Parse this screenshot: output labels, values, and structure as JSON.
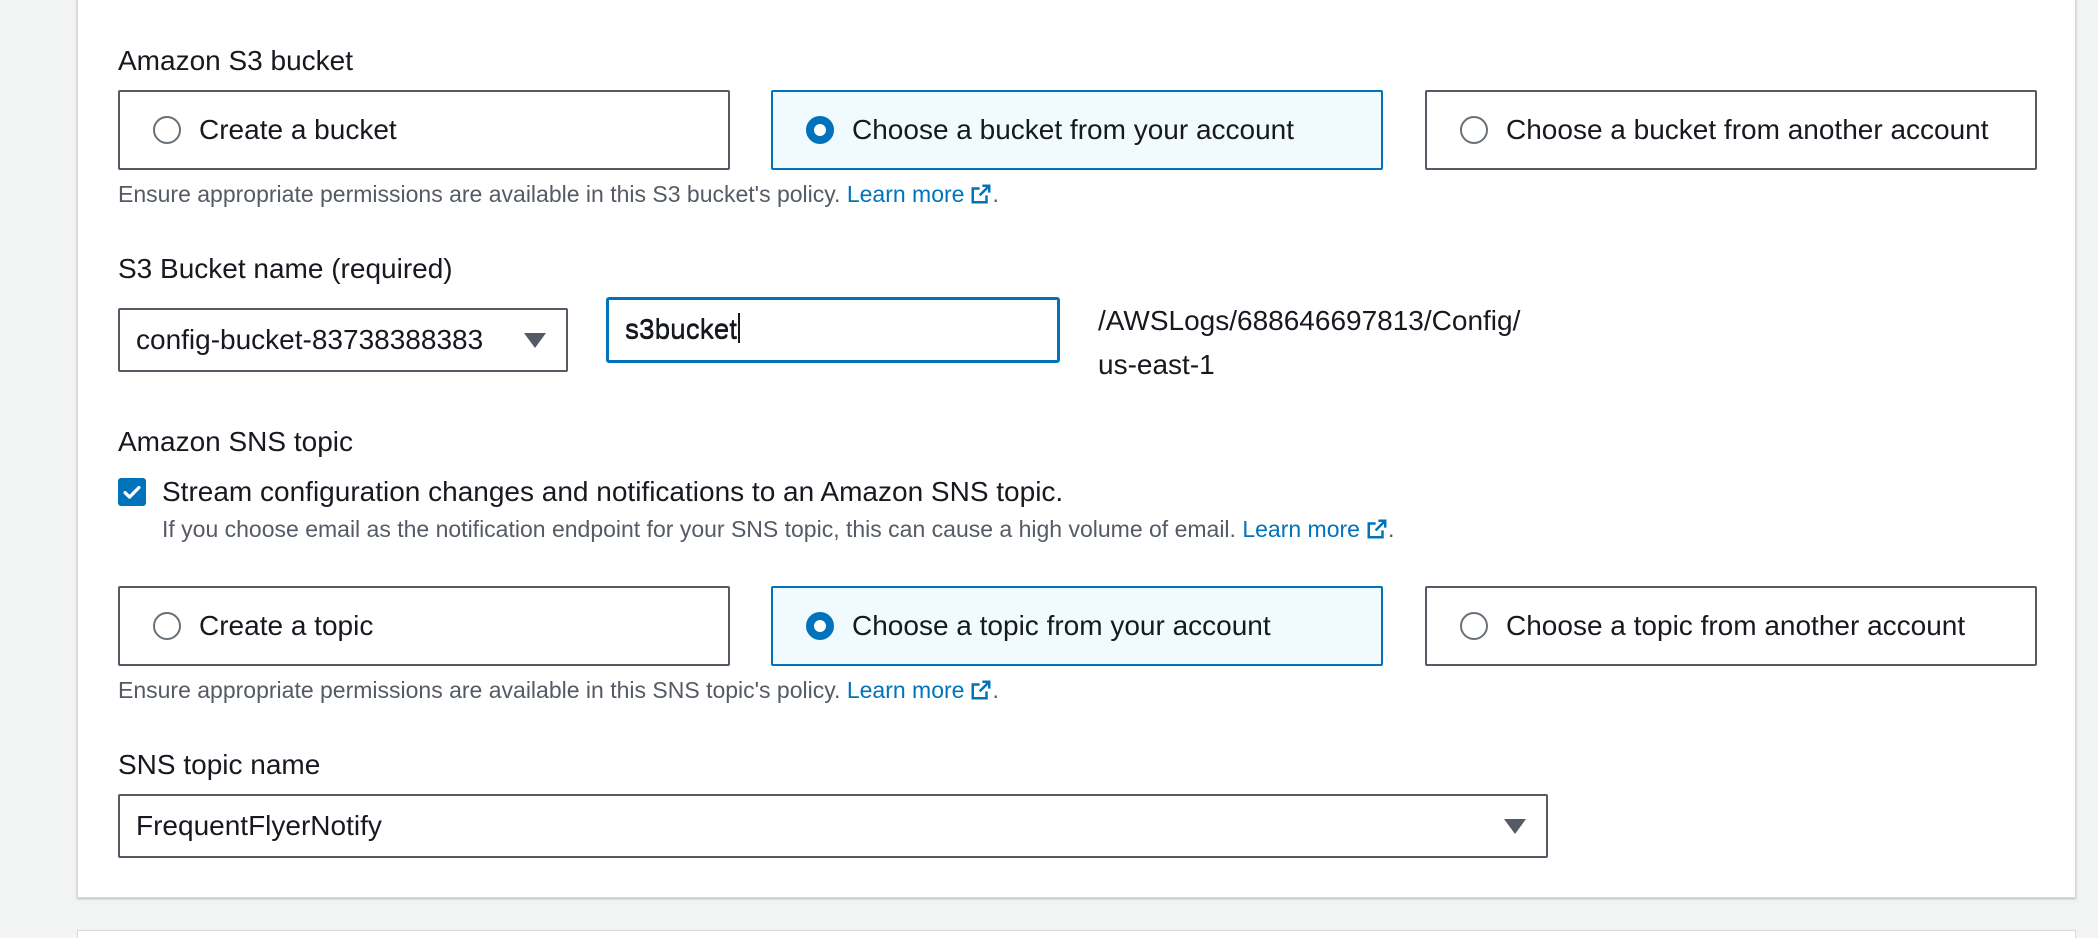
{
  "s3": {
    "section_label": "Amazon S3 bucket",
    "options": [
      {
        "label": "Create a bucket",
        "selected": false
      },
      {
        "label": "Choose a bucket from your account",
        "selected": true
      },
      {
        "label": "Choose a bucket from another account",
        "selected": false
      }
    ],
    "hint_text": "Ensure appropriate permissions are available in this S3 bucket's policy.",
    "hint_link": "Learn more",
    "hint_suffix": ".",
    "bucket_name_label": "S3 Bucket name (required)",
    "bucket_select_value": "config-bucket-83738388383",
    "prefix_value": "s3bucket",
    "path_line1": "/AWSLogs/688646697813/Config/",
    "path_line2": "us-east-1"
  },
  "sns": {
    "section_label": "Amazon SNS topic",
    "stream_checkbox_label": "Stream configuration changes and notifications to an Amazon SNS topic.",
    "stream_checked": true,
    "stream_hint": "If you choose email as the notification endpoint for your SNS topic, this can cause a high volume of email.",
    "stream_hint_link": "Learn more",
    "stream_hint_suffix": ".",
    "options": [
      {
        "label": "Create a topic",
        "selected": false
      },
      {
        "label": "Choose a topic from your account",
        "selected": true
      },
      {
        "label": "Choose a topic from another account",
        "selected": false
      }
    ],
    "hint_text": "Ensure appropriate permissions are available in this SNS topic's policy.",
    "hint_link": "Learn more",
    "hint_suffix": ".",
    "topic_name_label": "SNS topic name",
    "topic_select_value": "FrequentFlyerNotify"
  },
  "colors": {
    "accent": "#0073bb",
    "selected_bg": "#f1faff",
    "border": "#545b64",
    "text": "#16191f",
    "muted": "#545b64"
  },
  "icons": {
    "external_link": "external-link-icon",
    "dropdown": "caret-down-icon",
    "check": "check-icon"
  }
}
